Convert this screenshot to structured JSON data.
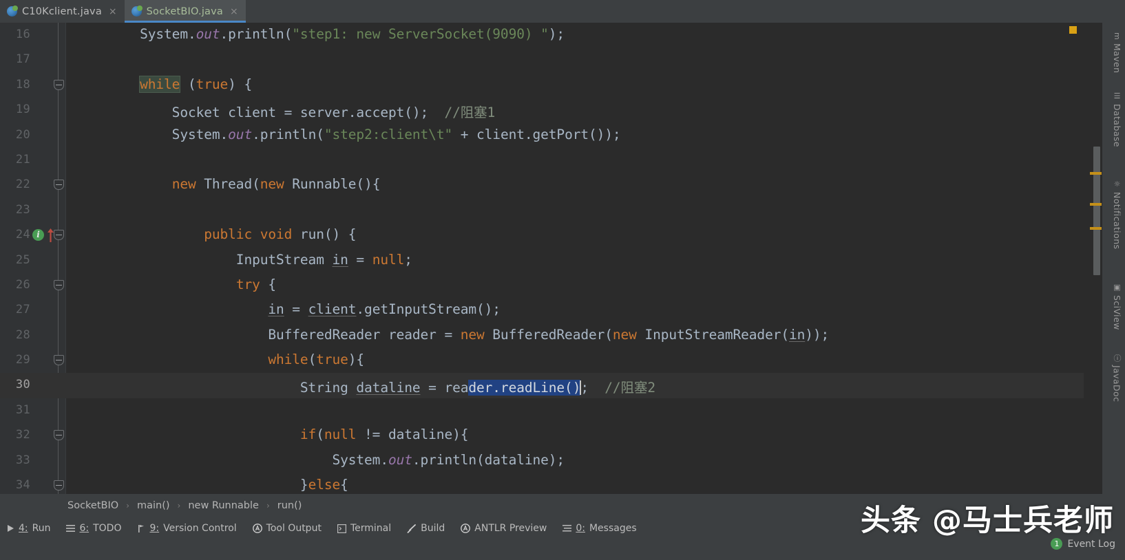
{
  "window": {
    "app": "IntelliJ IDEA",
    "theme_background": "#2b2b2b",
    "panel_background": "#3c3f41",
    "accent": "#4a88c7",
    "selection_color": "#214283",
    "keyword_color": "#cc7832",
    "string_color": "#6a8759",
    "comment_color": "#808d7c",
    "field_color": "#9876aa",
    "warning_color": "#d9a115",
    "run_green": "#499c54"
  },
  "tabs": [
    {
      "label": "C10Kclient.java",
      "icon": "java-class-icon",
      "close": "×",
      "active": false
    },
    {
      "label": "SocketBIO.java",
      "icon": "java-class-icon",
      "close": "×",
      "active": true
    }
  ],
  "editor": {
    "first_visible_line": 16,
    "caret_line": 30,
    "lines": [
      {
        "n": "16",
        "fold": null,
        "gutter_icon": null,
        "tokens": [
          {
            "t": "        System.",
            "c": "id"
          },
          {
            "t": "out",
            "c": "fld"
          },
          {
            "t": ".println(",
            "c": "id"
          },
          {
            "t": "\"step1: new ServerSocket(9090) \"",
            "c": "str"
          },
          {
            "t": ");",
            "c": "id"
          }
        ]
      },
      {
        "n": "17",
        "fold": null,
        "gutter_icon": null,
        "tokens": []
      },
      {
        "n": "18",
        "fold": "fold-minus",
        "gutter_icon": null,
        "tokens": [
          {
            "t": "        ",
            "c": "id"
          },
          {
            "t": "while",
            "c": "kwhl"
          },
          {
            "t": " (",
            "c": "id"
          },
          {
            "t": "true",
            "c": "kw"
          },
          {
            "t": ") {",
            "c": "id"
          }
        ]
      },
      {
        "n": "19",
        "fold": null,
        "gutter_icon": null,
        "tokens": [
          {
            "t": "            Socket client = server.accept();  ",
            "c": "id"
          },
          {
            "t": "//阻塞1",
            "c": "cmt"
          }
        ]
      },
      {
        "n": "20",
        "fold": null,
        "gutter_icon": null,
        "tokens": [
          {
            "t": "            System.",
            "c": "id"
          },
          {
            "t": "out",
            "c": "fld"
          },
          {
            "t": ".println(",
            "c": "id"
          },
          {
            "t": "\"step2:client\\t\"",
            "c": "str"
          },
          {
            "t": " + client.getPort());",
            "c": "id"
          }
        ]
      },
      {
        "n": "21",
        "fold": null,
        "gutter_icon": null,
        "tokens": []
      },
      {
        "n": "22",
        "fold": "fold-minus",
        "gutter_icon": null,
        "tokens": [
          {
            "t": "            ",
            "c": "id"
          },
          {
            "t": "new",
            "c": "kw"
          },
          {
            "t": " Thread(",
            "c": "id"
          },
          {
            "t": "new",
            "c": "kw"
          },
          {
            "t": " Runnable(){",
            "c": "id"
          }
        ]
      },
      {
        "n": "23",
        "fold": null,
        "gutter_icon": null,
        "tokens": []
      },
      {
        "n": "24",
        "fold": "fold-minus",
        "gutter_icon": "run-override-icon",
        "tokens": [
          {
            "t": "                ",
            "c": "id"
          },
          {
            "t": "public",
            "c": "kw"
          },
          {
            "t": " ",
            "c": "id"
          },
          {
            "t": "void",
            "c": "kw"
          },
          {
            "t": " run() {",
            "c": "id"
          }
        ]
      },
      {
        "n": "25",
        "fold": null,
        "gutter_icon": null,
        "tokens": [
          {
            "t": "                    InputStream ",
            "c": "id"
          },
          {
            "t": "in",
            "c": "u"
          },
          {
            "t": " = ",
            "c": "id"
          },
          {
            "t": "null",
            "c": "kw"
          },
          {
            "t": ";",
            "c": "id"
          }
        ]
      },
      {
        "n": "26",
        "fold": "fold-minus",
        "gutter_icon": null,
        "tokens": [
          {
            "t": "                    ",
            "c": "id"
          },
          {
            "t": "try",
            "c": "kw"
          },
          {
            "t": " {",
            "c": "id"
          }
        ]
      },
      {
        "n": "27",
        "fold": null,
        "gutter_icon": null,
        "tokens": [
          {
            "t": "                        ",
            "c": "id"
          },
          {
            "t": "in",
            "c": "u"
          },
          {
            "t": " = ",
            "c": "id"
          },
          {
            "t": "client",
            "c": "u"
          },
          {
            "t": ".getInputStream();",
            "c": "id"
          }
        ]
      },
      {
        "n": "28",
        "fold": null,
        "gutter_icon": null,
        "tokens": [
          {
            "t": "                        BufferedReader reader = ",
            "c": "id"
          },
          {
            "t": "new",
            "c": "kw"
          },
          {
            "t": " BufferedReader(",
            "c": "id"
          },
          {
            "t": "new",
            "c": "kw"
          },
          {
            "t": " InputStreamReader(",
            "c": "id"
          },
          {
            "t": "in",
            "c": "u"
          },
          {
            "t": "));",
            "c": "id"
          }
        ]
      },
      {
        "n": "29",
        "fold": "fold-minus",
        "gutter_icon": null,
        "tokens": [
          {
            "t": "                        ",
            "c": "id"
          },
          {
            "t": "while",
            "c": "kw"
          },
          {
            "t": "(",
            "c": "id"
          },
          {
            "t": "true",
            "c": "kw"
          },
          {
            "t": "){",
            "c": "id"
          }
        ]
      },
      {
        "n": "30",
        "fold": null,
        "gutter_icon": null,
        "current": true,
        "tokens": [
          {
            "t": "                            String ",
            "c": "id"
          },
          {
            "t": "dataline",
            "c": "u"
          },
          {
            "t": " = rea",
            "c": "id"
          },
          {
            "t": "der.readLine()",
            "c": "sel"
          },
          {
            "t": "caret",
            "c": "caret"
          },
          {
            "t": ";  ",
            "c": "id"
          },
          {
            "t": "//阻塞2",
            "c": "cmt"
          }
        ]
      },
      {
        "n": "31",
        "fold": null,
        "gutter_icon": null,
        "tokens": []
      },
      {
        "n": "32",
        "fold": "fold-minus",
        "gutter_icon": null,
        "tokens": [
          {
            "t": "                            ",
            "c": "id"
          },
          {
            "t": "if",
            "c": "kw"
          },
          {
            "t": "(",
            "c": "id"
          },
          {
            "t": "null",
            "c": "kw"
          },
          {
            "t": " != dataline){",
            "c": "id"
          }
        ]
      },
      {
        "n": "33",
        "fold": null,
        "gutter_icon": null,
        "tokens": [
          {
            "t": "                                System.",
            "c": "id"
          },
          {
            "t": "out",
            "c": "fld"
          },
          {
            "t": ".println(dataline);",
            "c": "id"
          }
        ]
      },
      {
        "n": "34",
        "fold": "fold-minus",
        "gutter_icon": null,
        "tokens": [
          {
            "t": "                            }",
            "c": "id"
          },
          {
            "t": "else",
            "c": "kw"
          },
          {
            "t": "{",
            "c": "id"
          }
        ]
      }
    ]
  },
  "right_tool_window": {
    "items": [
      {
        "label": "Maven",
        "icon": "maven-icon"
      },
      {
        "label": "Database",
        "icon": "database-icon"
      },
      {
        "label": "Notifications",
        "icon": "bell-icon"
      },
      {
        "label": "SciView",
        "icon": "sciview-icon"
      },
      {
        "label": "JavaDoc",
        "icon": "javadoc-icon"
      }
    ]
  },
  "breadcrumb": {
    "separator": "›",
    "items": [
      "SocketBIO",
      "main()",
      "new Runnable",
      "run()"
    ]
  },
  "statusbar": {
    "items": [
      {
        "num": "4",
        "label": "Run",
        "icon": "play-icon"
      },
      {
        "num": "6",
        "label": "TODO",
        "icon": "list-icon"
      },
      {
        "num": "9",
        "label": "Version Control",
        "icon": "branch-icon"
      },
      {
        "num": "",
        "label": "Tool Output",
        "icon": "circle-a-icon"
      },
      {
        "num": "",
        "label": "Terminal",
        "icon": "terminal-icon"
      },
      {
        "num": "",
        "label": "Build",
        "icon": "hammer-icon"
      },
      {
        "num": "",
        "label": "ANTLR Preview",
        "icon": "circle-a-icon"
      },
      {
        "num": "0",
        "label": "Messages",
        "icon": "messages-icon"
      }
    ],
    "event_log": {
      "label": "Event Log",
      "count": "1"
    }
  },
  "watermark": {
    "text": "头条 @马士兵老师"
  }
}
